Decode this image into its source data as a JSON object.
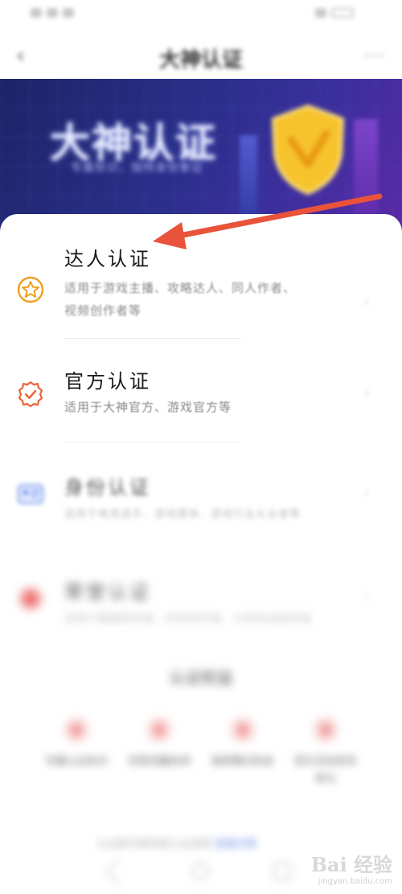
{
  "nav": {
    "title": "大神认证",
    "back_icon": "chevron-left-icon",
    "more_icon": "more-dots-icon"
  },
  "banner": {
    "title": "大神认证",
    "subtitle": "专属标识，独特身份象征"
  },
  "items": [
    {
      "title": "达人认证",
      "desc": "适用于游戏主播、攻略达人、同人作者、视频创作者等",
      "icon": "star-badge-icon",
      "color": "#f0a020"
    },
    {
      "title": "官方认证",
      "desc": "适用于大神官方、游戏官方等",
      "icon": "ribbon-check-icon",
      "color": "#e8663a"
    },
    {
      "title": "身份认证",
      "desc": "适用于电竞选手、游戏媒体、游戏行业从业者等",
      "icon": "id-card-icon",
      "color": "#6a8de8"
    },
    {
      "title": "荣誉认证",
      "desc": "适用于赛事获奖者、优秀创作者、大神活动获奖者",
      "icon": "honor-badge-icon",
      "color": "#f07070"
    }
  ],
  "benefits_title": "认证权益",
  "benefits": [
    {
      "label": "专属认证标识"
    },
    {
      "label": "优质流量扶持"
    },
    {
      "label": "独家曝光机会"
    },
    {
      "label": "官方活动优先参与"
    }
  ],
  "footer": {
    "note": "认证即代表同意认证说明",
    "link": "查看详情"
  },
  "watermark": {
    "logo": "Bai 经验",
    "url": "jingyan.baidu.com"
  },
  "accent": "#e8533a"
}
